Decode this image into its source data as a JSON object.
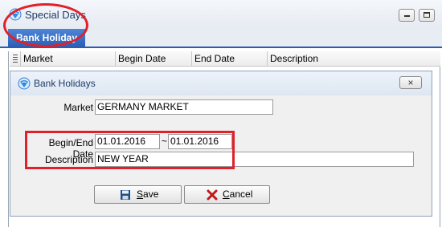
{
  "window": {
    "title": "Special Days",
    "tab_active": "Bank Holiday"
  },
  "grid": {
    "columns": [
      "Market",
      "Begin Date",
      "End Date",
      "Description"
    ]
  },
  "dialog": {
    "title": "Bank Holidays",
    "close_label": "×",
    "market_label": "Market",
    "market_value": "GERMANY MARKET",
    "begin_end_label": "Begin/End Date",
    "begin_date": "01.01.2016",
    "range_separator": "~",
    "end_date": "01.01.2016",
    "description_label": "Description",
    "description_value": "NEW YEAR",
    "save_label": "Save",
    "cancel_label": "Cancel"
  },
  "colors": {
    "highlight": "#e0202a",
    "tab_accent": "#2b5fb8"
  }
}
